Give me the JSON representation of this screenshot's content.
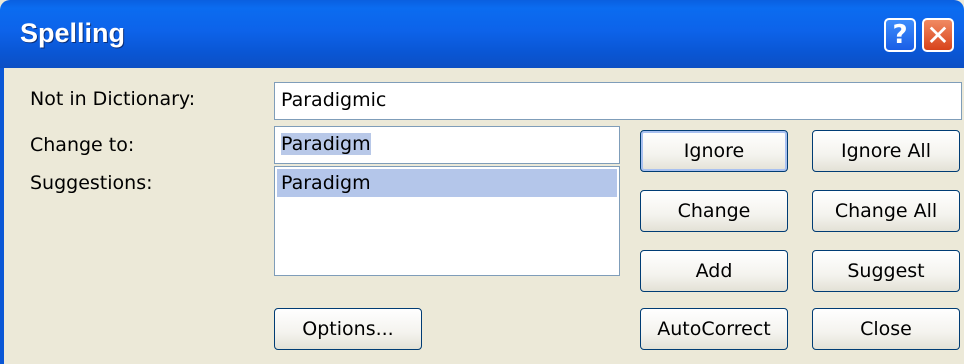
{
  "window": {
    "title": "Spelling"
  },
  "titlebar": {
    "help_glyph": "?",
    "close_glyph": "✕"
  },
  "labels": {
    "not_in_dictionary": "Not in Dictionary:",
    "change_to": "Change to:",
    "suggestions": "Suggestions:"
  },
  "fields": {
    "not_in_dictionary_value": "Paradigmic",
    "change_to_value": "Paradigm"
  },
  "suggestions": [
    "Paradigm"
  ],
  "buttons": {
    "options": "Options...",
    "ignore": "Ignore",
    "ignore_all": "Ignore All",
    "change": "Change",
    "change_all": "Change All",
    "add": "Add",
    "suggest": "Suggest",
    "autocorrect": "AutoCorrect",
    "close": "Close"
  },
  "colors": {
    "titlebar_blue": "#0a57d6",
    "dialog_bg": "#ece9d8",
    "selection": "#b4c6ea",
    "close_red": "#d8431b"
  }
}
